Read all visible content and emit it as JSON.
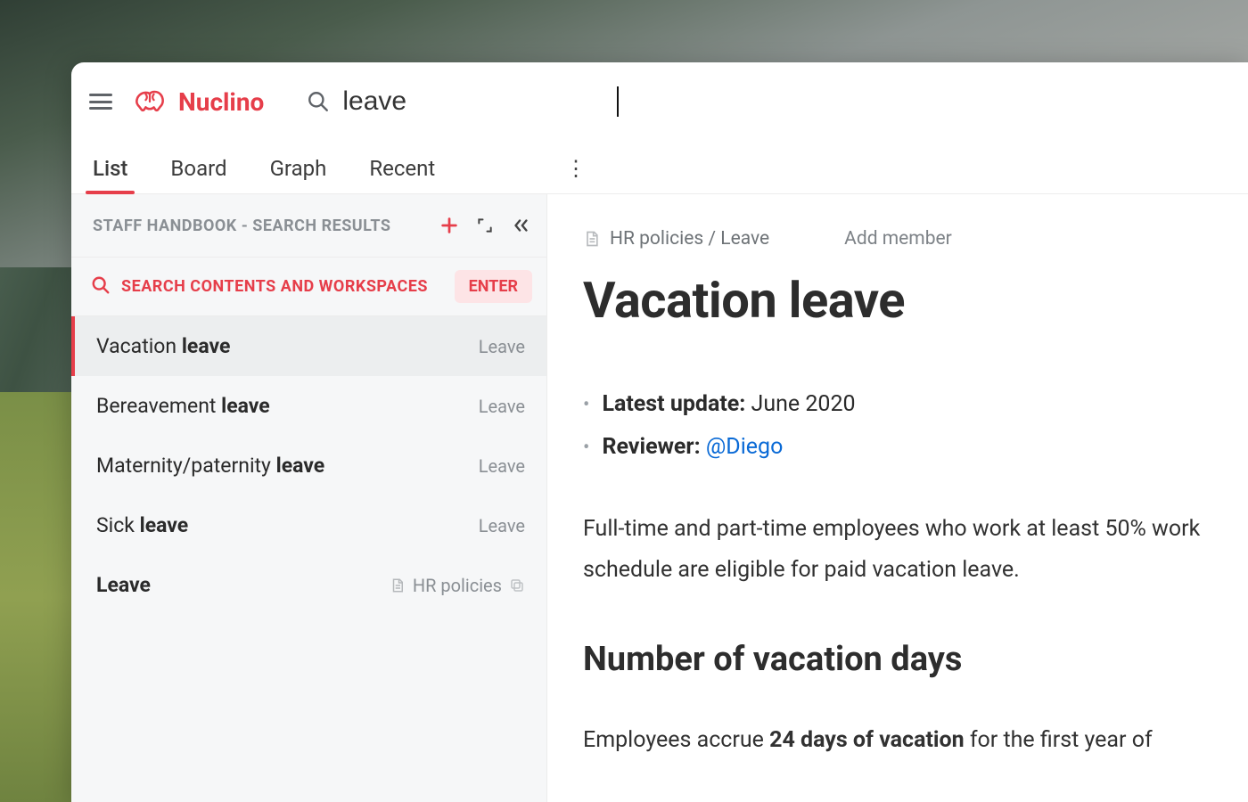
{
  "brand": {
    "name": "Nuclino"
  },
  "search": {
    "value": "leave"
  },
  "tabs": {
    "list": "List",
    "board": "Board",
    "graph": "Graph",
    "recent": "Recent"
  },
  "sidebar": {
    "header": "STAFF HANDBOOK - SEARCH RESULTS",
    "search_contents_label": "SEARCH CONTENTS AND WORKSPACES",
    "enter_label": "ENTER",
    "results": [
      {
        "title_plain": "Vacation ",
        "title_bold": "leave",
        "category": "Leave",
        "active": true
      },
      {
        "title_plain": "Bereavement ",
        "title_bold": "leave",
        "category": "Leave"
      },
      {
        "title_plain": "Maternity/paternity ",
        "title_bold": "leave",
        "category": "Leave"
      },
      {
        "title_plain": "Sick ",
        "title_bold": "leave",
        "category": "Leave"
      },
      {
        "title_plain": "",
        "title_bold": "Leave",
        "category": "HR policies",
        "has_doc_icon": true
      }
    ]
  },
  "doc": {
    "breadcrumb": "HR policies / Leave",
    "add_member": "Add member",
    "title": "Vacation leave",
    "meta": {
      "update_key": "Latest update:",
      "update_value": "June 2020",
      "reviewer_key": "Reviewer:",
      "reviewer_value": "@Diego"
    },
    "para1": "Full-time and part-time employees who work at least 50% work schedule are eligible for paid vacation leave.",
    "h2": "Number of vacation days",
    "para2_a": "Employees accrue ",
    "para2_b": "24 days of vacation",
    "para2_c": " for the first year of"
  }
}
